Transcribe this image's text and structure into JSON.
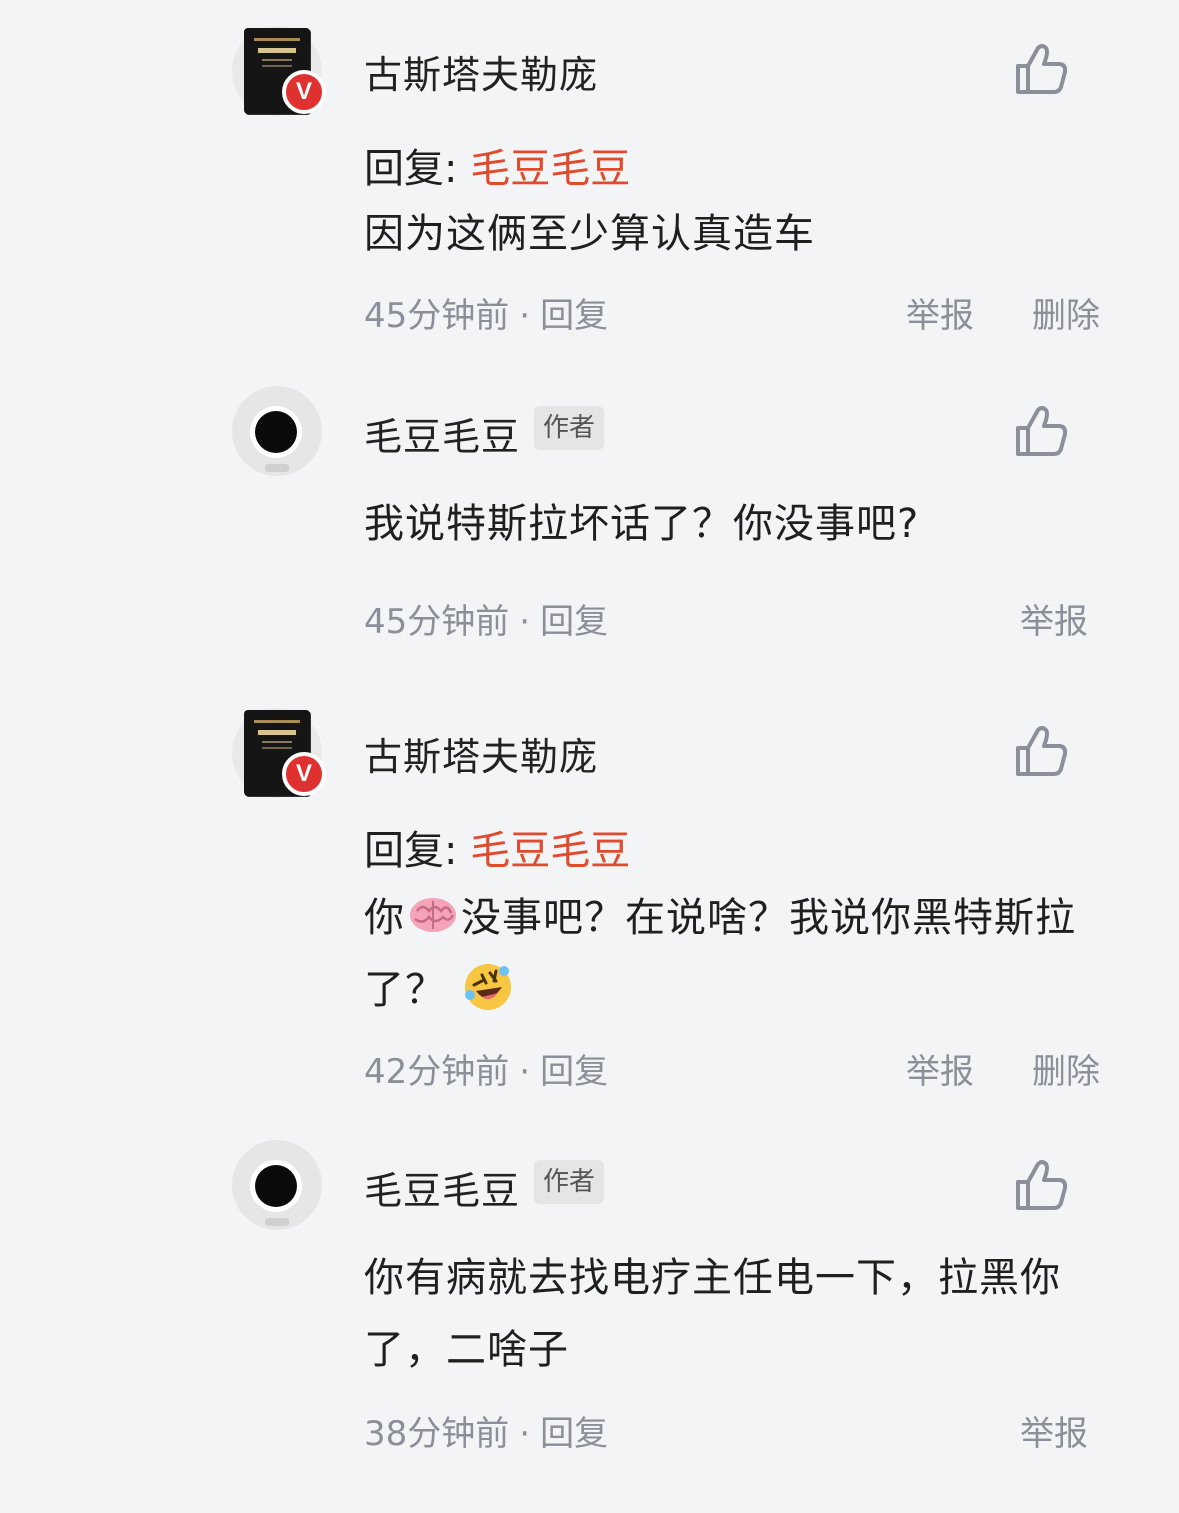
{
  "comments": [
    {
      "username": "古斯塔夫勒庞",
      "verified_badge": "V",
      "reply_prefix": "回复:",
      "reply_target": "毛豆毛豆",
      "body": "因为这俩至少算认真造车",
      "time": "45分钟前",
      "reply_label": "回复",
      "report_label": "举报",
      "delete_label": "删除"
    },
    {
      "username": "毛豆毛豆",
      "author_tag": "作者",
      "body": "我说特斯拉坏话了？你没事吧?",
      "time": "45分钟前",
      "reply_label": "回复",
      "report_label": "举报"
    },
    {
      "username": "古斯塔夫勒庞",
      "verified_badge": "V",
      "reply_prefix": "回复:",
      "reply_target": "毛豆毛豆",
      "body_part1": "你",
      "body_part2": "没事吧？在说啥？我说你黑特斯拉",
      "body_part3": "了？",
      "time": "42分钟前",
      "reply_label": "回复",
      "report_label": "举报",
      "delete_label": "删除"
    },
    {
      "username": "毛豆毛豆",
      "author_tag": "作者",
      "body": "你有病就去找电疗主任电一下，拉黑你了，二啥子",
      "time": "38分钟前",
      "reply_label": "回复",
      "report_label": "举报"
    }
  ],
  "separator": "·",
  "colors": {
    "background": "#f3f4f5",
    "reply_target": "#e04a2d",
    "meta_text": "#8a8f99",
    "verified_badge": "#e03131"
  },
  "icons": {
    "like": "thumbs-up-icon",
    "brain": "brain-emoji",
    "laugh": "rolling-laugh-emoji"
  }
}
